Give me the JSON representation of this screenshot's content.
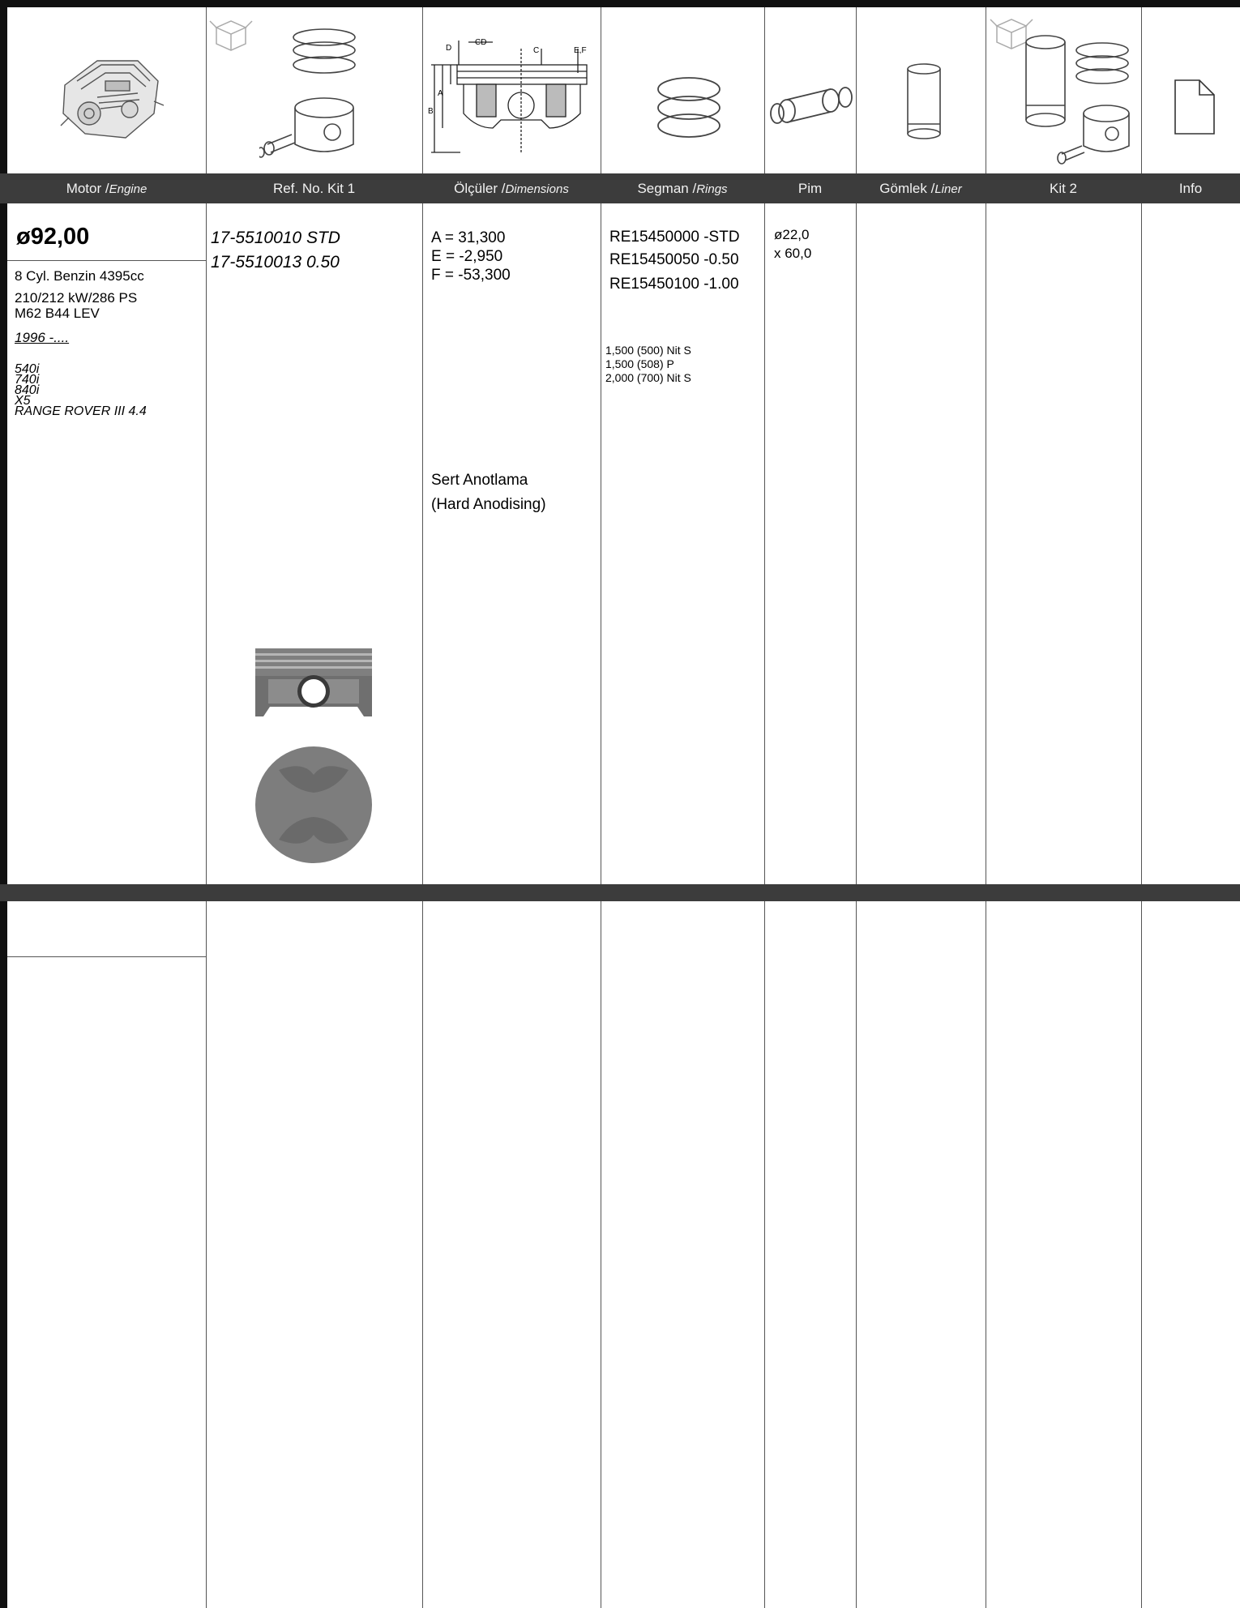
{
  "headers": {
    "engine_label": "Motor /",
    "engine_sub": "Engine",
    "ref_label": "Ref. No. Kit 1",
    "dim_label": "Ölçüler /",
    "dim_sub": "Dimensions",
    "rings_label": "Segman /",
    "rings_sub": "Rings",
    "pin_label": "Pim",
    "liner_label": "Gömlek /",
    "liner_sub": "Liner",
    "kit2_label": "Kit 2",
    "info_label": "Info"
  },
  "diagram_labels": {
    "d": "D",
    "cd": "CD",
    "c": "C",
    "ef": "E,F",
    "a": "A",
    "b": "B"
  },
  "engine": {
    "bore": "ø92,00",
    "line1": "8 Cyl. Benzin 4395cc",
    "line2": "210/212 kW/286 PS",
    "line3": "M62 B44 LEV",
    "years": "1996 -....",
    "models": [
      "540i",
      "740i",
      "840i",
      "X5",
      "RANGE ROVER III 4.4"
    ]
  },
  "refs": [
    "17-5510010  STD",
    "17-5510013  0.50"
  ],
  "dimensions": [
    "A  = 31,300",
    "E  = -2,950",
    "F  = -53,300"
  ],
  "coating": [
    "Sert Anotlama",
    "(Hard Anodising)"
  ],
  "rings": [
    "RE15450000 -STD",
    "RE15450050 -0.50",
    "RE15450100 -1.00"
  ],
  "ring_specs": [
    "1,500   (500) Nit S",
    "1,500   (508) P",
    "2,000   (700) Nit S"
  ],
  "pin": [
    "ø22,0",
    "x 60,0"
  ]
}
